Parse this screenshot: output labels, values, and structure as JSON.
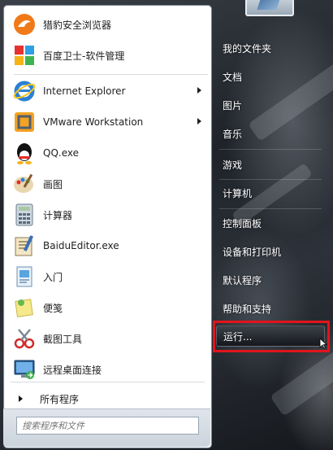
{
  "programs": [
    {
      "label": "猎豹安全浏览器",
      "icon": "liebao-browser-icon",
      "submenu": false
    },
    {
      "label": "百度卫士-软件管理",
      "icon": "software-manager-icon",
      "submenu": false
    },
    {
      "label": "Internet Explorer",
      "icon": "internet-explorer-icon",
      "submenu": true
    },
    {
      "label": "VMware Workstation",
      "icon": "vmware-icon",
      "submenu": true
    },
    {
      "label": "QQ.exe",
      "icon": "qq-icon",
      "submenu": false
    },
    {
      "label": "画图",
      "icon": "paint-icon",
      "submenu": false
    },
    {
      "label": "计算器",
      "icon": "calculator-icon",
      "submenu": false
    },
    {
      "label": "BaiduEditor.exe",
      "icon": "baidu-editor-icon",
      "submenu": false
    },
    {
      "label": "入门",
      "icon": "getting-started-icon",
      "submenu": false
    },
    {
      "label": "便笺",
      "icon": "sticky-notes-icon",
      "submenu": false
    },
    {
      "label": "截图工具",
      "icon": "snipping-tool-icon",
      "submenu": false
    },
    {
      "label": "远程桌面连接",
      "icon": "remote-desktop-icon",
      "submenu": false
    }
  ],
  "all_programs_label": "所有程序",
  "search": {
    "placeholder": "搜索程序和文件",
    "value": ""
  },
  "places": [
    "我的文件夹",
    "文档",
    "图片",
    "音乐",
    "游戏",
    "计算机",
    "控制面板",
    "设备和打印机",
    "默认程序",
    "帮助和支持"
  ],
  "run_label": "运行...",
  "colors": {
    "highlight": "#e2141b",
    "menu_bg": "#ffffff"
  }
}
